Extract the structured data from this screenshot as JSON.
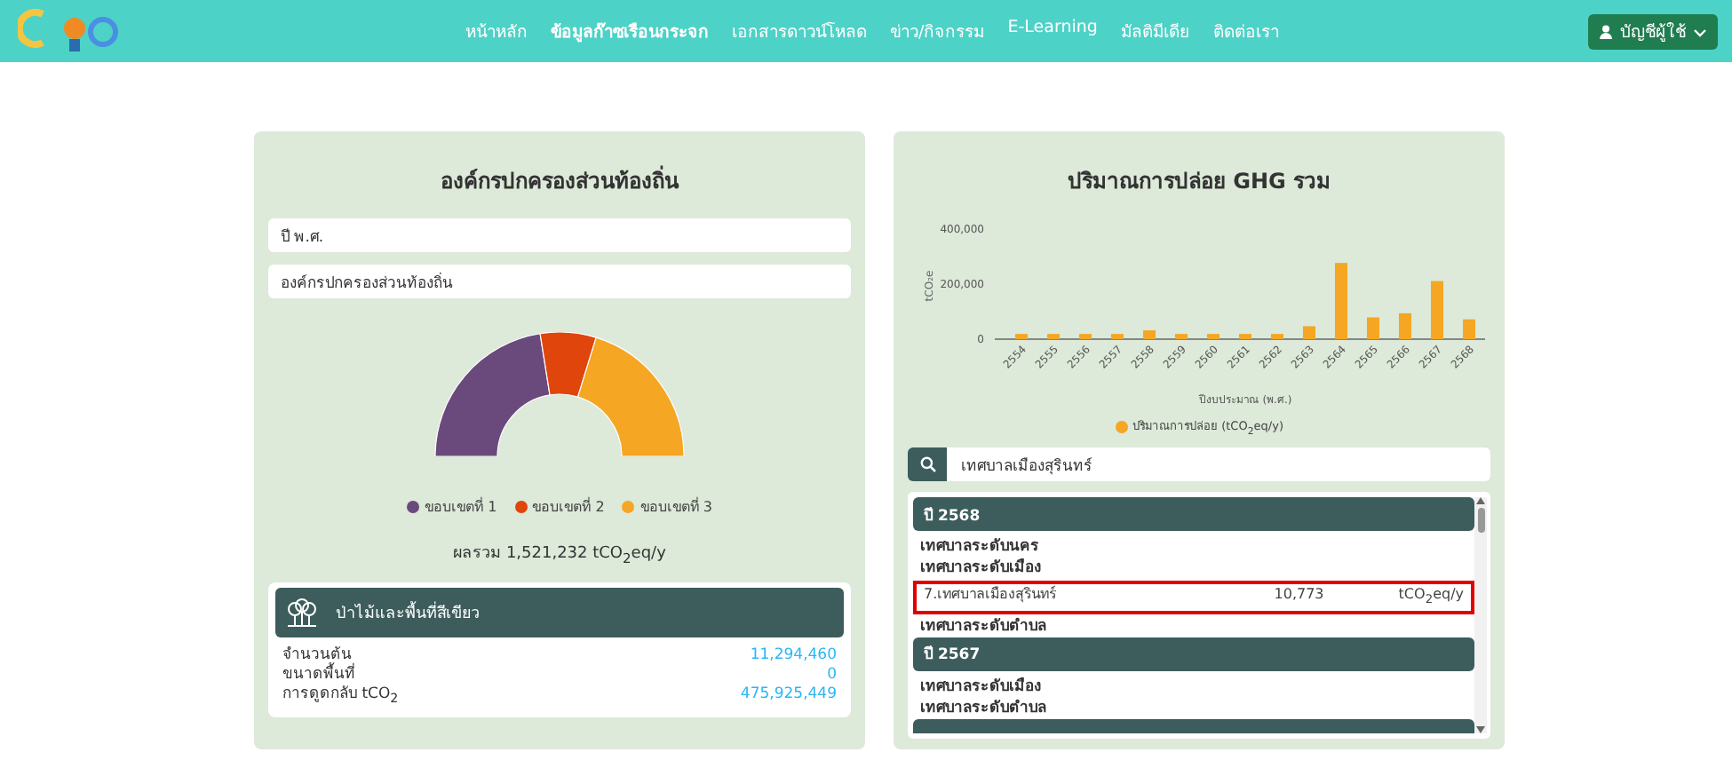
{
  "header": {
    "nav": [
      {
        "label": "หน้าหลัก",
        "selected": false
      },
      {
        "label": "ข้อมูลก๊าซเรือนกระจก",
        "selected": true
      },
      {
        "label": "เอกสารดาวน์โหลด",
        "selected": false
      },
      {
        "label": "ข่าว/กิจกรรม",
        "selected": false
      },
      {
        "label": "E-Learning",
        "selected": false
      },
      {
        "label": "มัลติมีเดีย",
        "selected": false
      },
      {
        "label": "ติดต่อเรา",
        "selected": false
      }
    ],
    "account_button": "บัญชีผู้ใช้"
  },
  "left_panel": {
    "title": "องค์กรปกครองส่วนท้องถิ่น",
    "filters": [
      {
        "value": "ปี พ.ศ."
      },
      {
        "value": "องค์กรปกครองส่วนท้องถิ่น"
      }
    ],
    "legend": [
      {
        "label": "ขอบเขตที่ 1",
        "color": "#6a4a7c"
      },
      {
        "label": "ขอบเขตที่ 2",
        "color": "#e0450c"
      },
      {
        "label": "ขอบเขตที่ 3",
        "color": "#f5a623"
      }
    ],
    "total": "ผลรวม 1,521,232 tCO$_{2}$eq/y",
    "forest": {
      "title": "ป่าไม้และพื้นที่สีเขียว",
      "rows": [
        {
          "label": "จำนวนต้น",
          "value": "11,294,460"
        },
        {
          "label": "ขนาดพื้นที่",
          "value": "0"
        },
        {
          "label": "การดูดกลับ tCO$_{2}$",
          "value": "475,925,449"
        }
      ]
    }
  },
  "right_panel": {
    "title": "ปริมาณการปล่อย GHG รวม",
    "chart_data": {
      "type": "bar",
      "xlabel": "ปีงบประมาณ (พ.ศ.)",
      "ylabel": "tCO₂e",
      "categories": [
        "2554",
        "2555",
        "2556",
        "2557",
        "2558",
        "2559",
        "2560",
        "2561",
        "2562",
        "2563",
        "2564",
        "2565",
        "2566",
        "2567",
        "2568"
      ],
      "series": [
        {
          "name": "ปริมาณการปล่อย (tCO$_{2}$eq/y)",
          "color": "#f5a623",
          "values": [
            19000,
            19000,
            19000,
            19000,
            32000,
            19000,
            19000,
            19000,
            19000,
            47000,
            277000,
            79000,
            94000,
            211000,
            72000
          ]
        }
      ],
      "ylim": [
        0,
        400000
      ],
      "yticks": [
        {
          "value": 0,
          "label": "0"
        },
        {
          "value": 200000,
          "label": "200,000"
        },
        {
          "value": 400000,
          "label": "400,000"
        }
      ]
    },
    "search": {
      "value": "เทศบาลเมืองสุรินทร์"
    },
    "groups": [
      {
        "title": "ปี 2568",
        "children": [
          {
            "label": "เทศบาลระดับนคร"
          },
          {
            "label": "เทศบาลระดับเมือง",
            "children": [
              {
                "label": "7.เทศบาลเมืองสุรินทร์",
                "value": "10,773",
                "unit": "tCO$_{2}$eq/y",
                "highlighted": true
              }
            ]
          },
          {
            "label": "เทศบาลระดับตำบล"
          }
        ]
      },
      {
        "title": "ปี 2567",
        "children": [
          {
            "label": "เทศบาลระดับเมือง"
          },
          {
            "label": "เทศบาลระดับตำบล"
          }
        ]
      }
    ]
  }
}
